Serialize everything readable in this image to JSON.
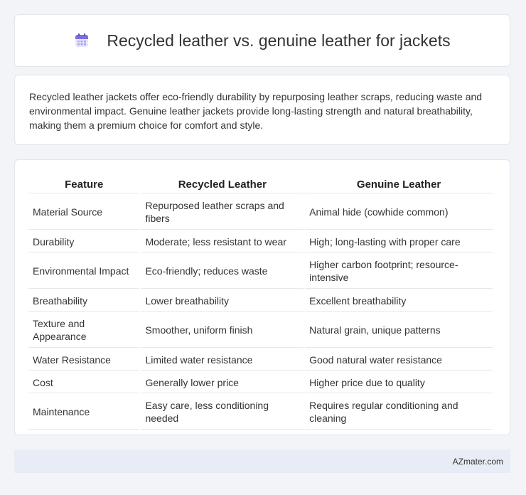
{
  "header": {
    "title": "Recycled leather vs. genuine leather for jackets",
    "icon": "calendar-icon"
  },
  "intro": {
    "text": "Recycled leather jackets offer eco-friendly durability by repurposing leather scraps, reducing waste and environmental impact. Genuine leather jackets provide long-lasting strength and natural breathability, making them a premium choice for comfort and style."
  },
  "table": {
    "headers": [
      "Feature",
      "Recycled Leather",
      "Genuine Leather"
    ],
    "rows": [
      [
        "Material Source",
        "Repurposed leather scraps and fibers",
        "Animal hide (cowhide common)"
      ],
      [
        "Durability",
        "Moderate; less resistant to wear",
        "High; long-lasting with proper care"
      ],
      [
        "Environmental Impact",
        "Eco-friendly; reduces waste",
        "Higher carbon footprint; resource-intensive"
      ],
      [
        "Breathability",
        "Lower breathability",
        "Excellent breathability"
      ],
      [
        "Texture and Appearance",
        "Smoother, uniform finish",
        "Natural grain, unique patterns"
      ],
      [
        "Water Resistance",
        "Limited water resistance",
        "Good natural water resistance"
      ],
      [
        "Cost",
        "Generally lower price",
        "Higher price due to quality"
      ],
      [
        "Maintenance",
        "Easy care, less conditioning needed",
        "Requires regular conditioning and cleaning"
      ]
    ]
  },
  "footer": {
    "brand": "AZmater.com"
  },
  "colors": {
    "background": "#f2f4f8",
    "card": "#ffffff",
    "footer": "#e7ecf6",
    "icon_accent": "#7b6fe0"
  }
}
